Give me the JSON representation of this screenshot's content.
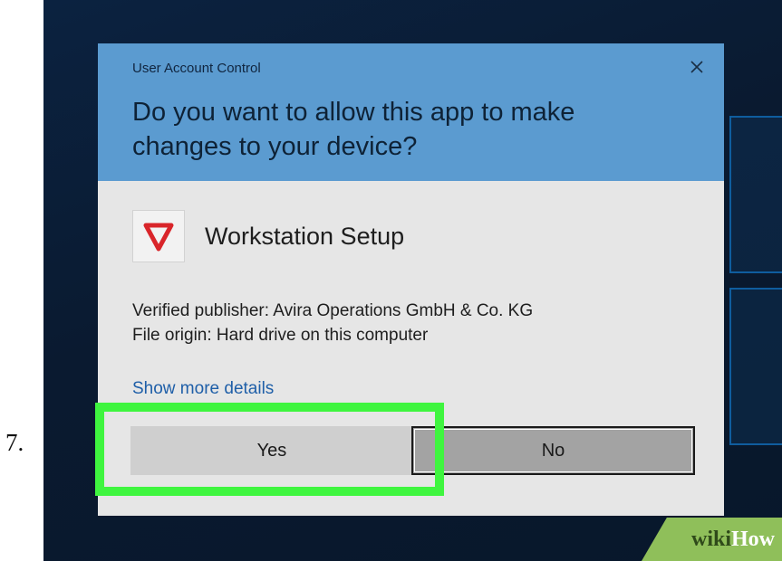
{
  "step": {
    "number": "7."
  },
  "dialog": {
    "caption": "User Account Control",
    "question": "Do you want to allow this app to make changes to your device?",
    "app_name": "Workstation Setup",
    "publisher_line": "Verified publisher: Avira Operations GmbH & Co. KG",
    "origin_line": "File origin: Hard drive on this computer",
    "details_link": "Show more details",
    "yes_label": "Yes",
    "no_label": "No",
    "icons": {
      "close": "close-icon",
      "app": "shield-icon"
    }
  },
  "watermark": {
    "part1": "wiki",
    "part2": "How"
  },
  "colors": {
    "header": "#5b9bd0",
    "body": "#e6e6e6",
    "highlight": "#3ff53f",
    "link": "#1f5fa8",
    "shield": "#d9252a",
    "watermark": "#8fbf5a"
  }
}
